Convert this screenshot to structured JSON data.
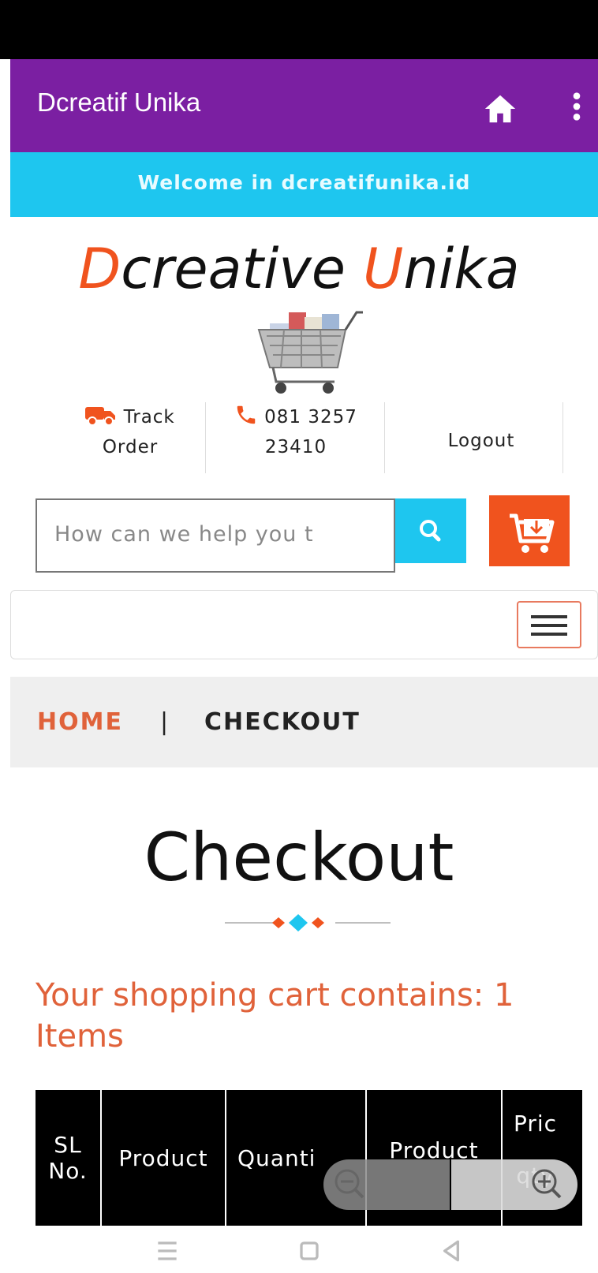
{
  "app_bar": {
    "title": "Dcreatif Unika"
  },
  "banner": {
    "text": "Welcome in dcreatifunika.id"
  },
  "logo": {
    "first_letter": "D",
    "word1_rest": "creative ",
    "second_letter": "U",
    "word2_rest": "nika"
  },
  "header_links": {
    "track_order": "Track Order",
    "track_line1": "Track",
    "track_line2": "Order",
    "phone_line1": "081 3257",
    "phone_line2": "23410",
    "logout": "Logout"
  },
  "search": {
    "placeholder": "How can we help you t"
  },
  "breadcrumb": {
    "home": "HOME",
    "separator": "|",
    "current": "CHECKOUT"
  },
  "page": {
    "title": "Checkout"
  },
  "cart": {
    "summary_line1": "Your shopping cart contains: 1",
    "summary_line2": "Items"
  },
  "table": {
    "headers": [
      "SL No.",
      "Product",
      "Quanti",
      "Product",
      "Pric"
    ],
    "sl_line1": "SL",
    "sl_line2": "No.",
    "price_line2": "qty"
  },
  "colors": {
    "purple": "#7b1fa2",
    "cyan": "#1ec6ef",
    "orange": "#f0531e"
  },
  "icons": [
    "home-icon",
    "more-vert-icon",
    "truck-icon",
    "phone-icon",
    "search-icon",
    "cart-icon",
    "menu-icon",
    "zoom-out-icon",
    "zoom-in-icon"
  ]
}
